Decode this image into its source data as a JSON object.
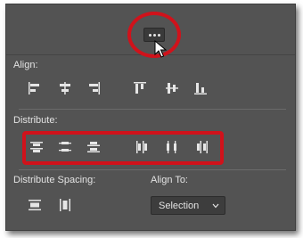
{
  "more_button": {
    "icon": "more-options-icon"
  },
  "align": {
    "label": "Align:",
    "icons": [
      "align-left-edges-icon",
      "align-horizontal-centers-icon",
      "align-right-edges-icon",
      "align-top-edges-icon",
      "align-vertical-centers-icon",
      "align-bottom-edges-icon"
    ]
  },
  "distribute": {
    "label": "Distribute:",
    "icons": [
      "distribute-top-edges-icon",
      "distribute-vertical-centers-icon",
      "distribute-bottom-edges-icon",
      "distribute-left-edges-icon",
      "distribute-horizontal-centers-icon",
      "distribute-right-edges-icon"
    ]
  },
  "distribute_spacing": {
    "label": "Distribute Spacing:",
    "icons": [
      "distribute-vertical-spacing-icon",
      "distribute-horizontal-spacing-icon"
    ]
  },
  "align_to": {
    "label": "Align To:",
    "selected": "Selection"
  },
  "colors": {
    "panel": "#535353",
    "highlight": "#d0121b",
    "text": "#e3e3e3"
  }
}
